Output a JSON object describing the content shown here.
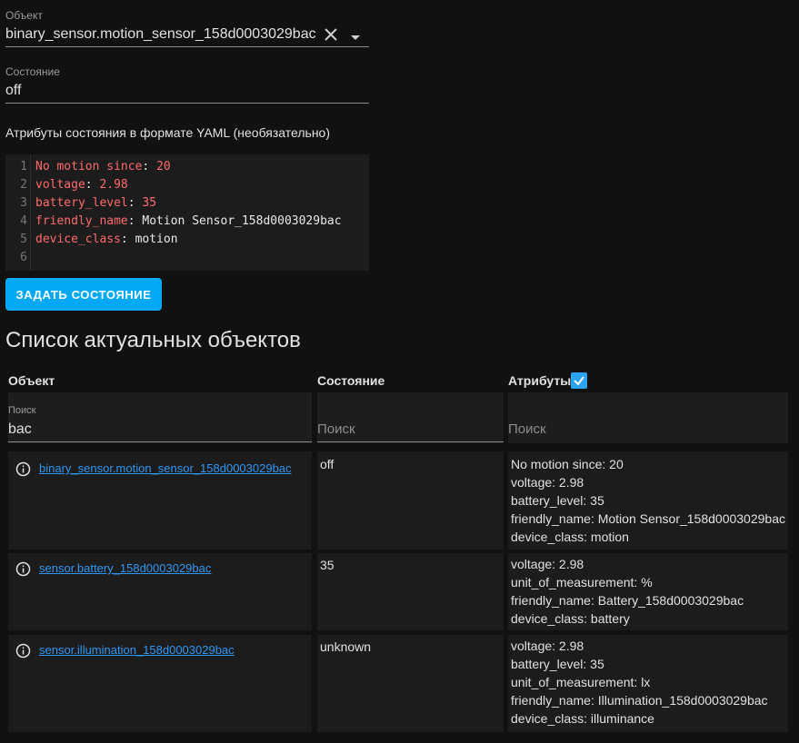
{
  "entity_field": {
    "label": "Объект",
    "value": "binary_sensor.motion_sensor_158d0003029bac",
    "clear_icon": "close-icon",
    "dropdown_icon": "chevron-down-icon"
  },
  "state_field": {
    "label": "Состояние",
    "value": "off"
  },
  "yaml": {
    "title": "Атрибуты состояния в формате YAML (необязательно)",
    "line_numbers": [
      "1",
      "2",
      "3",
      "4",
      "5",
      "6"
    ],
    "lines": [
      {
        "key": "No motion since",
        "sep": ": ",
        "value": "20",
        "value_type": "number"
      },
      {
        "key": "voltage",
        "sep": ": ",
        "value": "2.98",
        "value_type": "number"
      },
      {
        "key": "battery_level",
        "sep": ": ",
        "value": "35",
        "value_type": "number"
      },
      {
        "key": "friendly_name",
        "sep": ": ",
        "value": "Motion Sensor_158d0003029bac",
        "value_type": "string"
      },
      {
        "key": "device_class",
        "sep": ": ",
        "value": "motion",
        "value_type": "string"
      },
      {
        "key": "",
        "sep": "",
        "value": "",
        "value_type": "string"
      }
    ],
    "colors": {
      "key": "#ff6b6b",
      "number": "#ff6b6b",
      "string": "#e8e8e8"
    }
  },
  "set_state_button": "ЗАДАТЬ СОСТОЯНИЕ",
  "list_title": "Список актуальных объектов",
  "table": {
    "headers": {
      "entity": "Объект",
      "state": "Состояние",
      "attributes": "Атрибуты"
    },
    "attributes_checkbox_checked": true,
    "filters": {
      "entity": {
        "label": "Поиск",
        "value": "bac"
      },
      "state": {
        "placeholder": "Поиск"
      },
      "attributes": {
        "placeholder": "Поиск"
      }
    },
    "rows": [
      {
        "entity": "binary_sensor.motion_sensor_158d0003029bac",
        "state": "off",
        "attributes": [
          "No motion since: 20",
          "voltage: 2.98",
          "battery_level: 35",
          "friendly_name: Motion Sensor_158d0003029bac",
          "device_class: motion"
        ]
      },
      {
        "entity": "sensor.battery_158d0003029bac",
        "state": "35",
        "attributes": [
          "voltage: 2.98",
          "unit_of_measurement: %",
          "friendly_name: Battery_158d0003029bac",
          "device_class: battery"
        ]
      },
      {
        "entity": "sensor.illumination_158d0003029bac",
        "state": "unknown",
        "attributes": [
          "voltage: 2.98",
          "battery_level: 35",
          "unit_of_measurement: lx",
          "friendly_name: Illumination_158d0003029bac",
          "device_class: illuminance"
        ]
      }
    ]
  },
  "colors": {
    "accent": "#03a9f4",
    "link": "#2f96f3",
    "background": "#111111"
  }
}
